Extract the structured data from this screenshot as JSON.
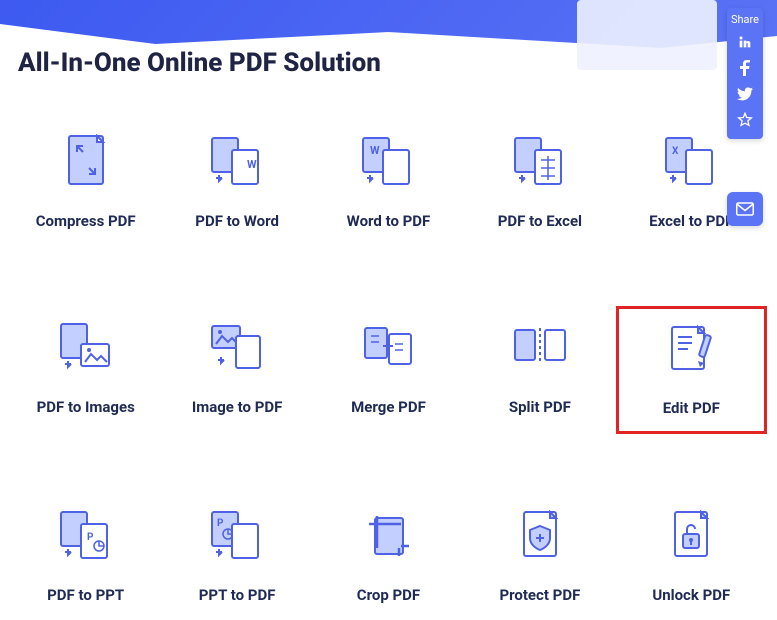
{
  "title": "All-In-One Online PDF Solution",
  "share": {
    "label": "Share"
  },
  "tools": [
    {
      "label": "Compress PDF"
    },
    {
      "label": "PDF to Word"
    },
    {
      "label": "Word to PDF"
    },
    {
      "label": "PDF to Excel"
    },
    {
      "label": "Excel to PDF"
    },
    {
      "label": "PDF to Images"
    },
    {
      "label": "Image to PDF"
    },
    {
      "label": "Merge PDF"
    },
    {
      "label": "Split PDF"
    },
    {
      "label": "Edit PDF"
    },
    {
      "label": "PDF to PPT"
    },
    {
      "label": "PPT to PDF"
    },
    {
      "label": "Crop PDF"
    },
    {
      "label": "Protect PDF"
    },
    {
      "label": "Unlock PDF"
    }
  ],
  "highlighted_index": 9,
  "colors": {
    "accent": "#5b73f5",
    "iconStroke": "#4f62e6",
    "iconFill": "#c3d0ff",
    "highlight": "#e02424",
    "text": "#1f2a55"
  }
}
